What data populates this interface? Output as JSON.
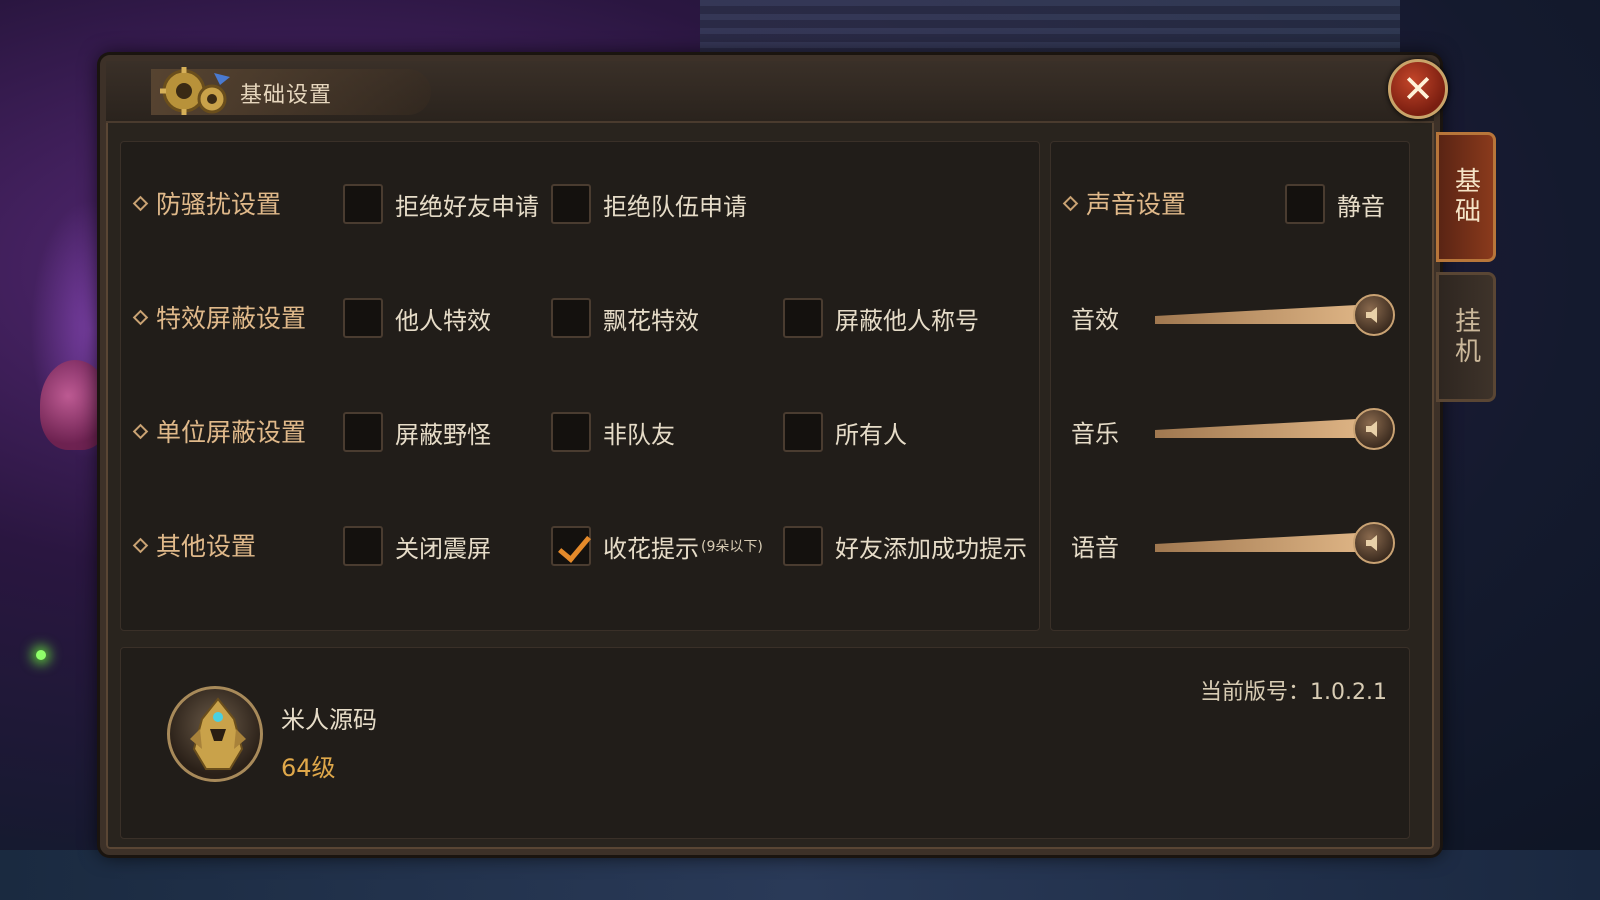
{
  "window": {
    "title": "基础设置",
    "close_label": "✕"
  },
  "tabs": [
    {
      "label": "基础",
      "active": true
    },
    {
      "label": "挂机",
      "active": false
    }
  ],
  "settings": {
    "rows": [
      {
        "label": "防骚扰设置",
        "options": [
          {
            "label": "拒绝好友申请",
            "checked": false
          },
          {
            "label": "拒绝队伍申请",
            "checked": false
          }
        ]
      },
      {
        "label": "特效屏蔽设置",
        "options": [
          {
            "label": "他人特效",
            "checked": false
          },
          {
            "label": "飘花特效",
            "checked": false
          },
          {
            "label": "屏蔽他人称号",
            "checked": false
          }
        ]
      },
      {
        "label": "单位屏蔽设置",
        "options": [
          {
            "label": "屏蔽野怪",
            "checked": false
          },
          {
            "label": "非队友",
            "checked": false
          },
          {
            "label": "所有人",
            "checked": false
          }
        ]
      },
      {
        "label": "其他设置",
        "options": [
          {
            "label": "关闭震屏",
            "checked": false
          },
          {
            "label": "收花提示",
            "note": "(9朵以下)",
            "checked": true
          },
          {
            "label": "好友添加成功提示",
            "checked": false
          }
        ]
      }
    ]
  },
  "sound": {
    "label": "声音设置",
    "mute": {
      "label": "静音",
      "checked": false
    },
    "sliders": [
      {
        "label": "音效",
        "level": 1.0
      },
      {
        "label": "音乐",
        "level": 1.0
      },
      {
        "label": "语音",
        "level": 1.0
      }
    ]
  },
  "profile": {
    "name": "米人源码",
    "level": "64级",
    "version": "当前版号：1.0.2.1"
  },
  "colors": {
    "accent": "#e0b98a",
    "check": "#e58a2a",
    "close": "#c4462a"
  }
}
